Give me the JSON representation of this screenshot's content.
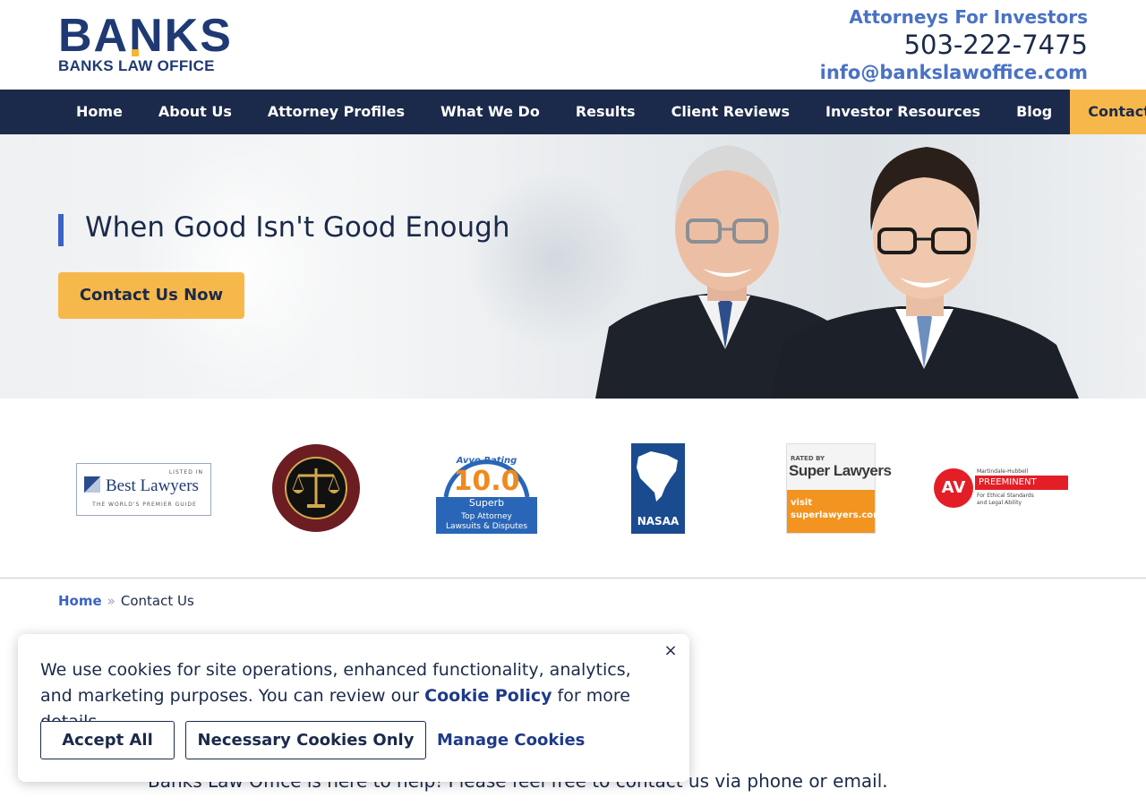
{
  "header": {
    "logo_text": "BANKS",
    "logo_subtext": "BANKS LAW OFFICE",
    "tagline": "Attorneys For Investors",
    "phone": "503-222-7475",
    "email": "info@bankslawoffice.com"
  },
  "nav": {
    "items": [
      {
        "label": "Home"
      },
      {
        "label": "About Us"
      },
      {
        "label": "Attorney Profiles"
      },
      {
        "label": "What We Do"
      },
      {
        "label": "Results"
      },
      {
        "label": "Client Reviews"
      },
      {
        "label": "Investor Resources"
      },
      {
        "label": "Blog"
      },
      {
        "label": "Contact Us",
        "active": true
      }
    ]
  },
  "hero": {
    "title": "When Good Isn't Good Enough",
    "cta_label": "Contact Us Now"
  },
  "awards": {
    "best_lawyers": {
      "top": "LISTED IN",
      "name": "Best Lawyers",
      "sub": "THE WORLD'S PREMIER GUIDE"
    },
    "multimillion": {
      "ring": "MULTI-MILLION DOLLAR · ADVOCATES FORUM"
    },
    "avvo": {
      "top": "Avvo Rating",
      "score": "10.0",
      "grade": "Superb",
      "line1": "Top Attorney",
      "line2": "Lawsuits & Disputes"
    },
    "nasaa": {
      "label": "NASAA"
    },
    "super_lawyers": {
      "top": "RATED BY",
      "name": "Super Lawyers",
      "visit": "visit",
      "site": "superlawyers.com"
    },
    "martindale": {
      "av": "AV",
      "top": "Martindale-Hubbell",
      "pre": "PREEMINENT",
      "sub1": "For Ethical Standards",
      "sub2": "and Legal Ability"
    }
  },
  "breadcrumb": {
    "home": "Home",
    "separator": "»",
    "current": "Contact Us"
  },
  "body": {
    "intro": "Banks Law Office is here to help!  Please feel free to contact us via phone or email."
  },
  "cookie": {
    "text_before": "We use cookies for site operations, enhanced functionality, analytics, and marketing purposes. You can review our ",
    "link": "Cookie Policy",
    "text_after": " for more details.",
    "accept": "Accept All",
    "necessary": "Necessary Cookies Only",
    "manage": "Manage Cookies",
    "close": "×"
  },
  "colors": {
    "navy": "#1b2a4a",
    "accent_blue": "#4a72c4",
    "gold": "#f7b84b"
  }
}
